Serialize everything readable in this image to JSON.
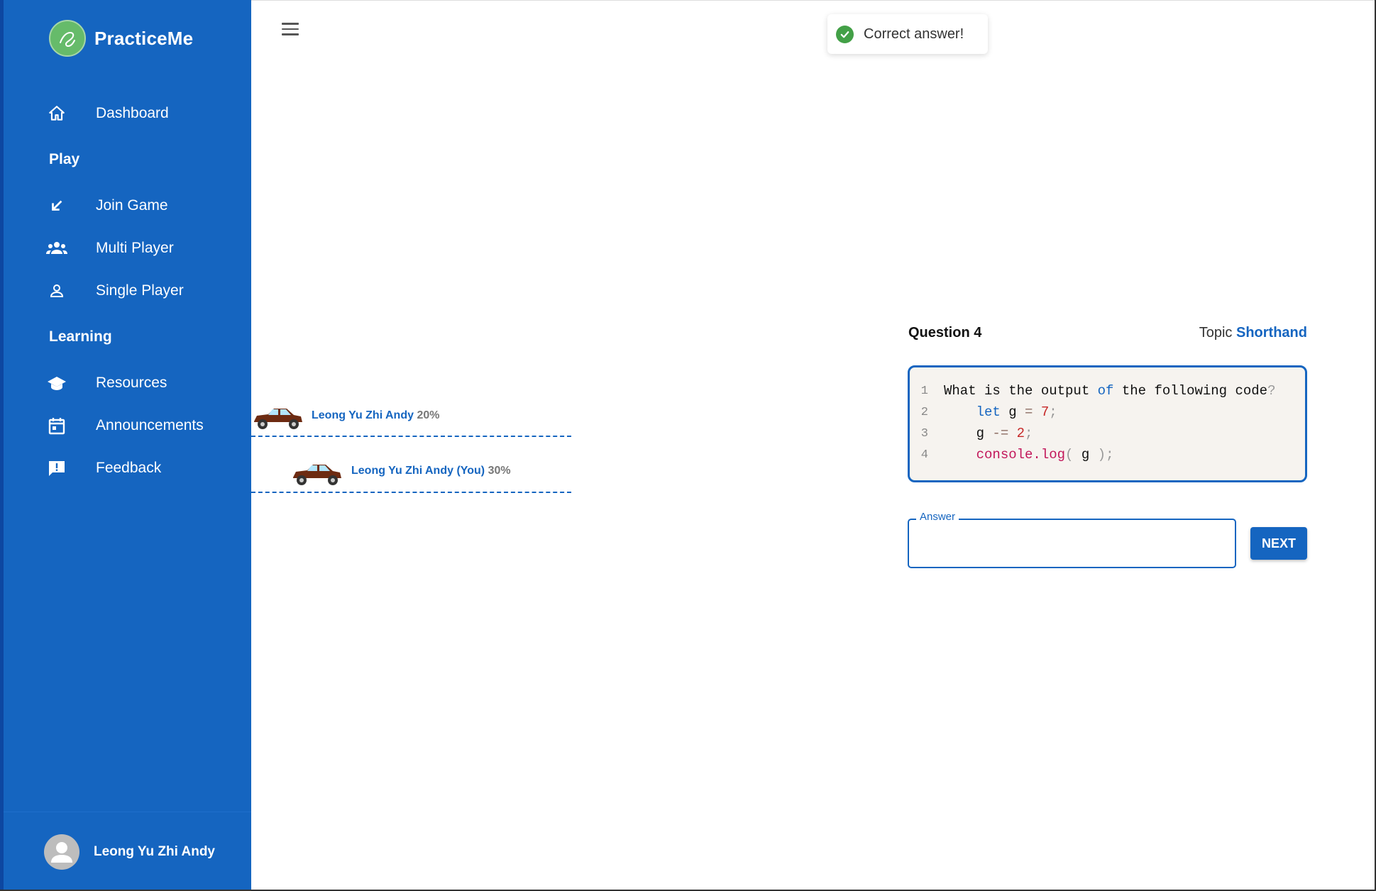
{
  "app": {
    "name": "PracticeMe"
  },
  "sidebar": {
    "items": [
      {
        "label": "Dashboard",
        "icon": "home-icon"
      },
      {
        "label": "Join Game",
        "icon": "arrow-down-left-icon"
      },
      {
        "label": "Multi Player",
        "icon": "group-icon"
      },
      {
        "label": "Single Player",
        "icon": "person-icon"
      },
      {
        "label": "Resources",
        "icon": "school-icon"
      },
      {
        "label": "Announcements",
        "icon": "calendar-icon"
      },
      {
        "label": "Feedback",
        "icon": "feedback-icon"
      }
    ],
    "sections": {
      "play": "Play",
      "learning": "Learning"
    },
    "user": {
      "name": "Leong Yu Zhi Andy"
    }
  },
  "toast": {
    "text": "Correct answer!"
  },
  "race": {
    "racers": [
      {
        "name": "Leong Yu Zhi Andy",
        "progress": "20%"
      },
      {
        "name": "Leong Yu Zhi Andy (You)",
        "progress": "30%"
      }
    ]
  },
  "question": {
    "title": "Question 4",
    "topic_label": "Topic",
    "topic_value": "Shorthand",
    "code_lines": [
      {
        "num": "1",
        "text": "What is the output of the following code?"
      },
      {
        "num": "2",
        "text": "    let g = 7;"
      },
      {
        "num": "3",
        "text": "    g -= 2;"
      },
      {
        "num": "4",
        "text": "    console.log( g );"
      }
    ]
  },
  "answer": {
    "label": "Answer",
    "value": ""
  },
  "buttons": {
    "next": "NEXT"
  },
  "colors": {
    "primary": "#1565c0",
    "success": "#43a047",
    "code_bg": "#f6f3ef"
  }
}
